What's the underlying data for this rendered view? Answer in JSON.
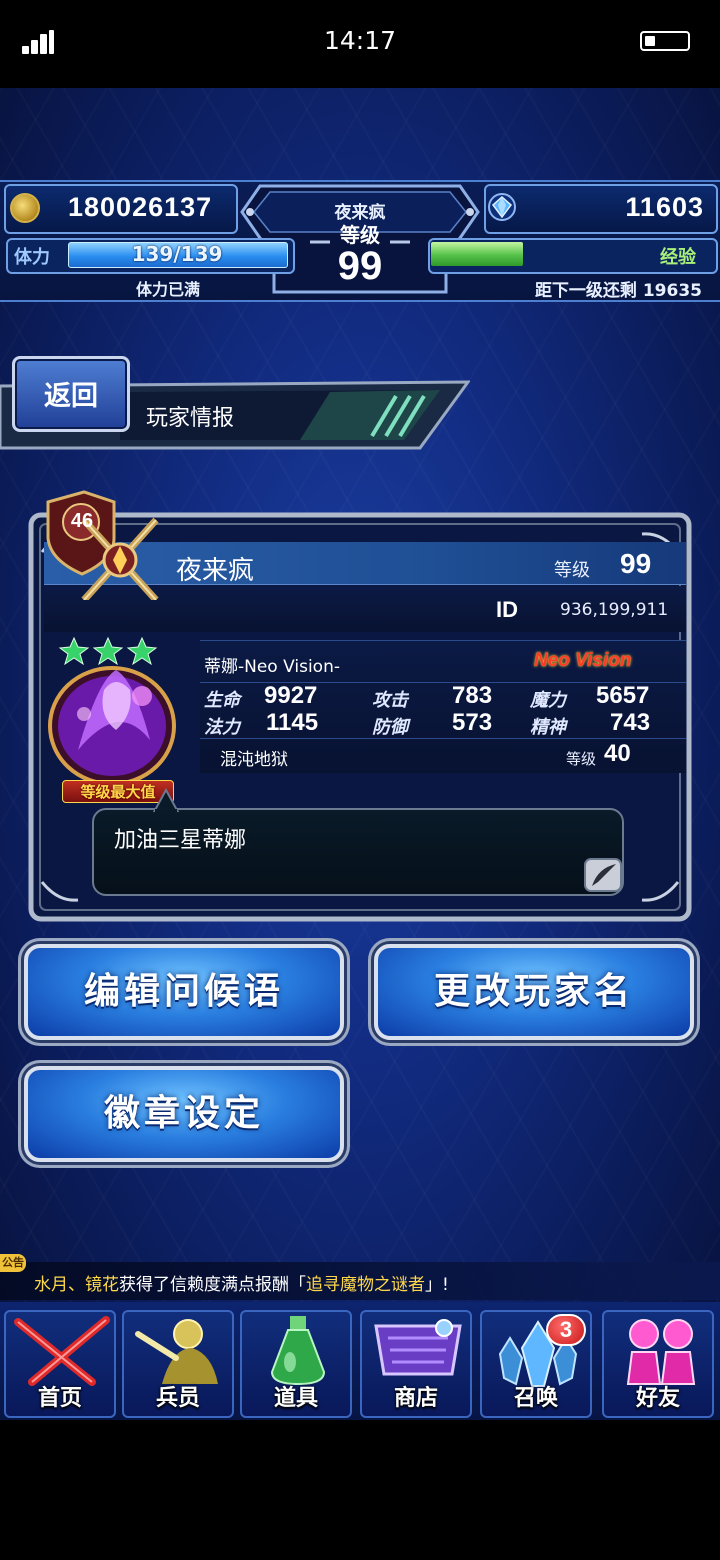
{
  "status_bar": {
    "time": "14:17"
  },
  "header": {
    "gold": "180026137",
    "gems": "11603",
    "player_name": "夜来疯",
    "level_label": "等级",
    "level": "99",
    "stamina_label": "体力",
    "stamina_value": "139/139",
    "stamina_status": "体力已满",
    "exp_label": "经验",
    "exp_remaining_text": "距下一级还剩 19635",
    "exp_fill": 0.33
  },
  "page": {
    "back_label": "返回",
    "title": "玩家情报"
  },
  "profile": {
    "rank_badge": "46",
    "name": "夜来疯",
    "level_label": "等级",
    "level": "99",
    "id_label": "ID",
    "id_value": "936,199,911",
    "stars": 3,
    "unit_name": "蒂娜-Neo Vision-",
    "unit_tag": "Neo Vision",
    "max_level_tag": "等级最大值",
    "stats": [
      {
        "label": "生命",
        "value": "9927"
      },
      {
        "label": "攻击",
        "value": "783"
      },
      {
        "label": "魔力",
        "value": "5657"
      },
      {
        "label": "法力",
        "value": "1145"
      },
      {
        "label": "防御",
        "value": "573"
      },
      {
        "label": "精神",
        "value": "743"
      }
    ],
    "esper_name": "混沌地狱",
    "esper_level_label": "等级",
    "esper_level": "40",
    "greeting": "加油三星蒂娜"
  },
  "actions": {
    "edit_greeting": "编辑问候语",
    "change_name": "更改玩家名",
    "badge_settings": "徽章设定"
  },
  "ticker": {
    "tag": "公告",
    "part1": "水月、镜花",
    "part2": "获得了信赖度满点报酬「",
    "part3": "追寻魔物之谜者",
    "part4": "」!"
  },
  "nav": {
    "home": "首页",
    "units": "兵员",
    "items": "道具",
    "shop": "商店",
    "summon": "召唤",
    "summon_badge": "3",
    "friends": "好友"
  }
}
